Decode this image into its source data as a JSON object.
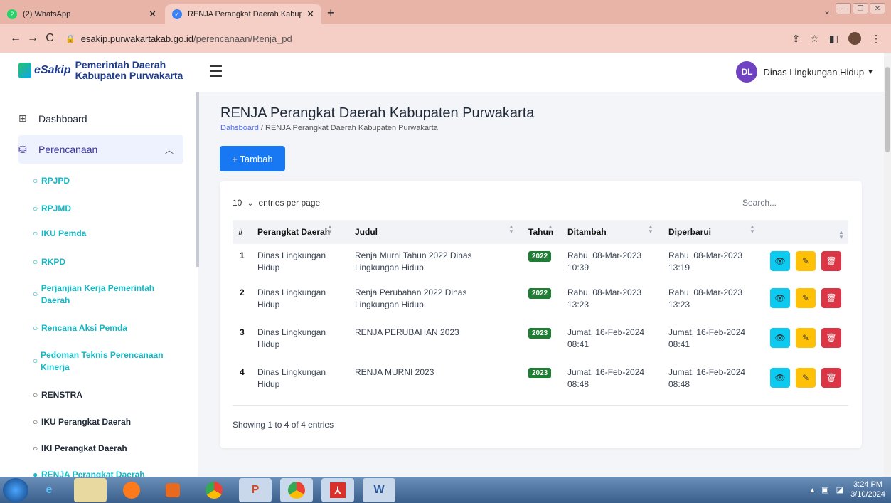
{
  "browser": {
    "tabs": [
      {
        "title": "(2) WhatsApp",
        "badge": "2"
      },
      {
        "title": "RENJA Perangkat Daerah Kabupa"
      }
    ],
    "url_host": "esakip.purwakartakab.go.id",
    "url_path": "/perencanaan/Renja_pd"
  },
  "header": {
    "logo_text": "eSakip",
    "org_line1": "Pemerintah Daerah",
    "org_line2": "Kabupaten Purwakarta",
    "user_initials": "DL",
    "user_name": "Dinas Lingkungan Hidup"
  },
  "sidebar": {
    "dashboard": "Dashboard",
    "perencanaan": "Perencanaan",
    "items": [
      {
        "label": "RPJPD"
      },
      {
        "label": "RPJMD"
      },
      {
        "label": "IKU Pemda"
      },
      {
        "label": "RKPD"
      },
      {
        "label": "Perjanjian Kerja Pemerintah Daerah"
      },
      {
        "label": "Rencana Aksi Pemda"
      },
      {
        "label": "Pedoman Teknis Perencanaan Kinerja"
      },
      {
        "label": "RENSTRA"
      },
      {
        "label": "IKU Perangkat Daerah"
      },
      {
        "label": "IKI Perangkat Daerah"
      },
      {
        "label": "RENJA Perangkat Daerah"
      }
    ]
  },
  "page": {
    "title": "RENJA Perangkat Daerah Kabupaten Purwakarta",
    "breadcrumb_link": "Dahsboard",
    "breadcrumb_sep": "/",
    "breadcrumb_current": "RENJA Perangkat Daerah Kabupaten Purwakarta",
    "add_button": "+ Tambah"
  },
  "table": {
    "per_page": "10",
    "per_page_label": "entries per page",
    "search_placeholder": "Search...",
    "columns": [
      "#",
      "Perangkat Daerah",
      "Judul",
      "Tahun",
      "Ditambah",
      "Diperbarui"
    ],
    "rows": [
      {
        "no": "1",
        "perangkat_1": "Dinas Lingkungan",
        "perangkat_2": "Hidup",
        "judul_1": "Renja Murni Tahun 2022 Dinas",
        "judul_2": "Lingkungan Hidup",
        "tahun": "2022",
        "ditambah_1": "Rabu, 08-Mar-2023",
        "ditambah_2": "10:39",
        "diperbarui_1": "Rabu, 08-Mar-2023",
        "diperbarui_2": "13:19"
      },
      {
        "no": "2",
        "perangkat_1": "Dinas Lingkungan",
        "perangkat_2": "Hidup",
        "judul_1": "Renja Perubahan 2022 Dinas",
        "judul_2": "Lingkungan Hidup",
        "tahun": "2022",
        "ditambah_1": "Rabu, 08-Mar-2023",
        "ditambah_2": "13:23",
        "diperbarui_1": "Rabu, 08-Mar-2023",
        "diperbarui_2": "13:23"
      },
      {
        "no": "3",
        "perangkat_1": "Dinas Lingkungan",
        "perangkat_2": "Hidup",
        "judul_1": "RENJA PERUBAHAN 2023",
        "judul_2": "",
        "tahun": "2023",
        "ditambah_1": "Jumat, 16-Feb-2024",
        "ditambah_2": "08:41",
        "diperbarui_1": "Jumat, 16-Feb-2024",
        "diperbarui_2": "08:41"
      },
      {
        "no": "4",
        "perangkat_1": "Dinas Lingkungan",
        "perangkat_2": "Hidup",
        "judul_1": "RENJA MURNI 2023",
        "judul_2": "",
        "tahun": "2023",
        "ditambah_1": "Jumat, 16-Feb-2024",
        "ditambah_2": "08:48",
        "diperbarui_1": "Jumat, 16-Feb-2024",
        "diperbarui_2": "08:48"
      }
    ],
    "footer": "Showing 1 to 4 of 4 entries"
  },
  "taskbar": {
    "time": "3:24 PM",
    "date": "3/10/2024"
  }
}
